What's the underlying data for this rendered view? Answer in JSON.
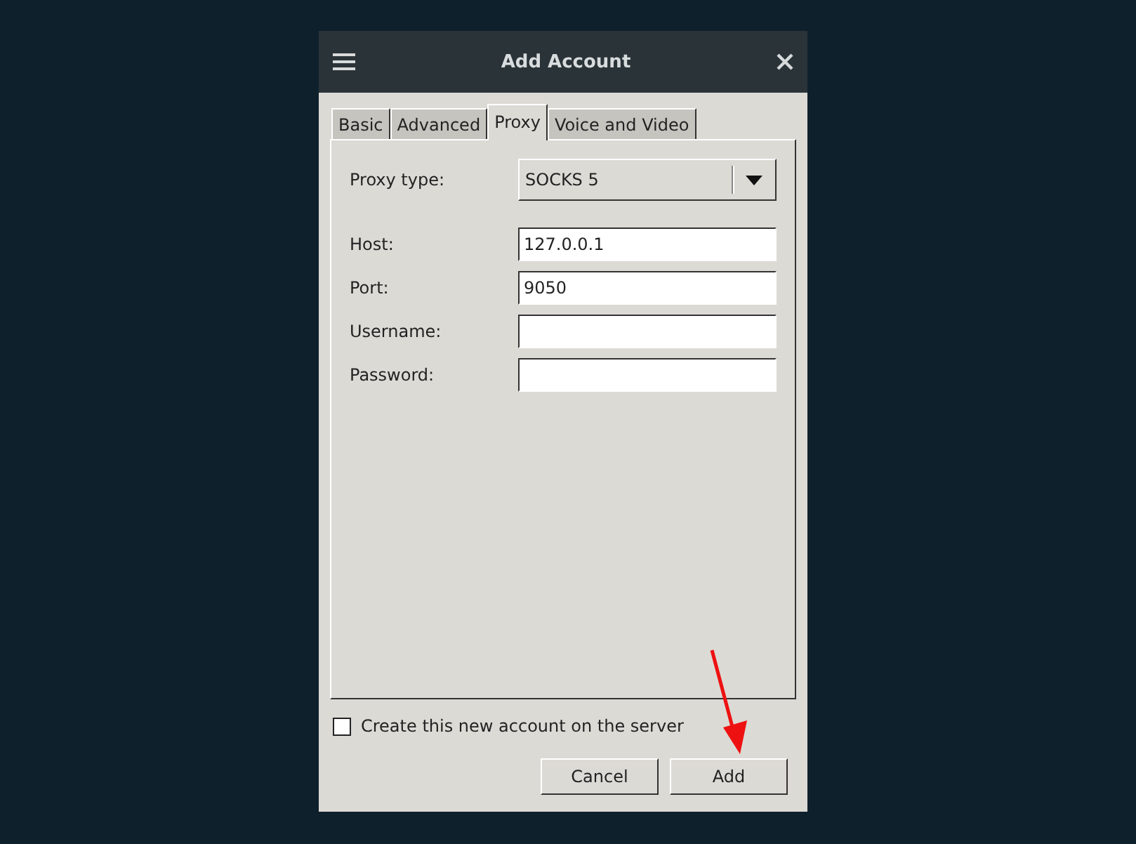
{
  "window": {
    "title": "Add Account"
  },
  "tabs": [
    {
      "label": "Basic",
      "selected": false
    },
    {
      "label": "Advanced",
      "selected": false
    },
    {
      "label": "Proxy",
      "selected": true
    },
    {
      "label": "Voice and Video",
      "selected": false
    }
  ],
  "proxy_type": {
    "label": "Proxy type:",
    "value": "SOCKS 5"
  },
  "fields": [
    {
      "label": "Host:",
      "value": "127.0.0.1"
    },
    {
      "label": "Port:",
      "value": "9050"
    },
    {
      "label": "Username:"
    },
    {
      "label": "Password:"
    }
  ],
  "create_on_server": {
    "label": "Create this new account on the server",
    "checked": false
  },
  "buttons": [
    "Cancel",
    "Add"
  ]
}
